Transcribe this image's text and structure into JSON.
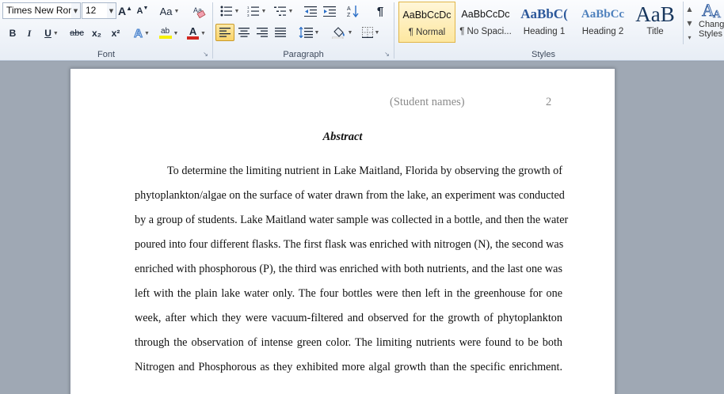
{
  "ribbon": {
    "font_group": {
      "label": "Font",
      "font_name": "Times New Rom",
      "font_size": "12",
      "grow_font": "A",
      "shrink_font": "A",
      "change_case": "Aa",
      "bold": "B",
      "italic": "I",
      "underline": "U",
      "strikethrough": "abc",
      "subscript": "x₂",
      "superscript": "x²",
      "font_color": "A",
      "highlight": "ab",
      "highlight_color": "#f6f000",
      "font_color_value": "#d1261f"
    },
    "paragraph_group": {
      "label": "Paragraph"
    },
    "styles_group": {
      "label": "Styles",
      "tiles": [
        {
          "sample": "AaBbCcDc",
          "name": "¶ Normal"
        },
        {
          "sample": "AaBbCcDc",
          "name": "¶ No Spaci..."
        },
        {
          "sample": "AaBbC(",
          "name": "Heading 1"
        },
        {
          "sample": "AaBbCc",
          "name": "Heading 2"
        },
        {
          "sample": "AaB",
          "name": "Title"
        }
      ],
      "change_styles": "Change Styles"
    },
    "accent_color": "#2b579a"
  },
  "document": {
    "running_head": "(Student names)",
    "page_number": "2",
    "title": "Abstract",
    "body_lines": [
      "To determine the limiting nutrient in Lake Maitland, Florida by observing the growth of",
      "phytoplankton/algae on the surface of water drawn from the lake, an experiment was conducted",
      "by a group of students. Lake Maitland water sample was collected in a bottle, and then the water",
      "poured into four different flasks. The first flask was enriched with nitrogen (N), the second was",
      "enriched with phosphorous (P), the third was enriched with both nutrients, and the last one was",
      "left with the plain lake water only. The four bottles were then left in the greenhouse for one",
      "week, after which they were vacuum-filtered and observed for the growth of phytoplankton",
      "through the observation of intense green color.  The limiting nutrients were found to be both",
      "Nitrogen and Phosphorous as they exhibited more algal growth than the specific enrichment."
    ]
  }
}
